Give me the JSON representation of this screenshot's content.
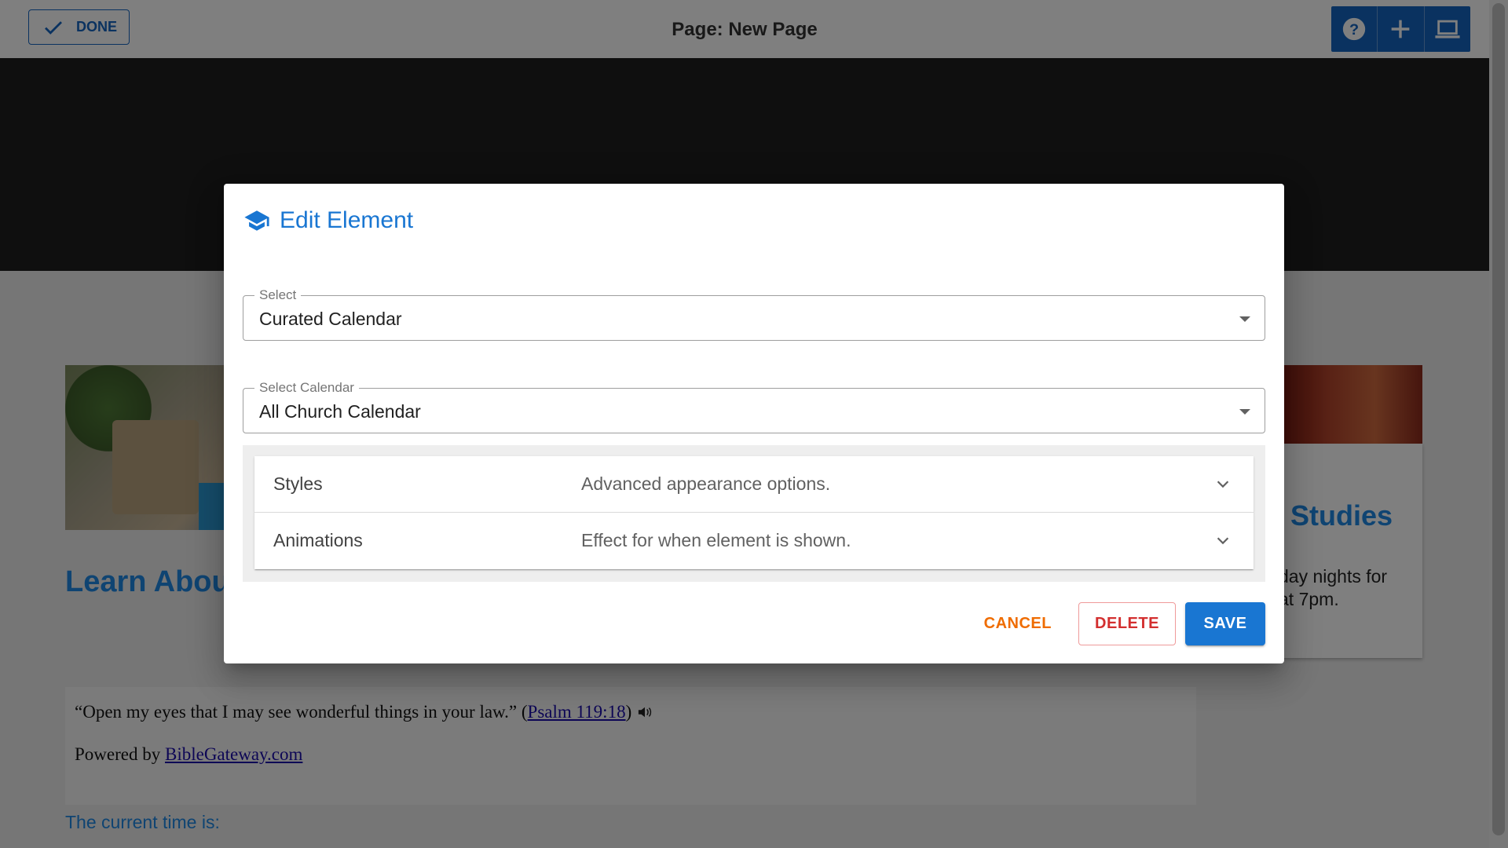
{
  "topbar": {
    "done_label": "DONE",
    "page_title": "Page: New Page",
    "tools": [
      "help-icon",
      "add-icon",
      "laptop-icon"
    ]
  },
  "background": {
    "heading_left": "Learn About",
    "heading_right": "Studies",
    "text_right_1": "day nights for",
    "text_right_2": "at 7pm.",
    "verse_text": "“Open my eyes that I may see wonderful things in your law.” (",
    "verse_link": "Psalm 119:18",
    "verse_close": ")",
    "powered_by_prefix": "Powered by ",
    "powered_by_link": "BibleGateway.com",
    "time_text": "The current time is:"
  },
  "dialog": {
    "title": "Edit Element",
    "title_icon": "graduation-cap-icon",
    "select": {
      "label": "Select",
      "value": "Curated Calendar"
    },
    "calendar_select": {
      "label": "Select Calendar",
      "value": "All Church Calendar"
    },
    "panels": [
      {
        "label": "Styles",
        "description": "Advanced appearance options."
      },
      {
        "label": "Animations",
        "description": "Effect for when element is shown."
      }
    ],
    "buttons": {
      "cancel": "CANCEL",
      "delete": "DELETE",
      "save": "SAVE"
    }
  },
  "colors": {
    "primary": "#1976d2",
    "cancel": "#ef6c00",
    "delete": "#d32f2f"
  }
}
